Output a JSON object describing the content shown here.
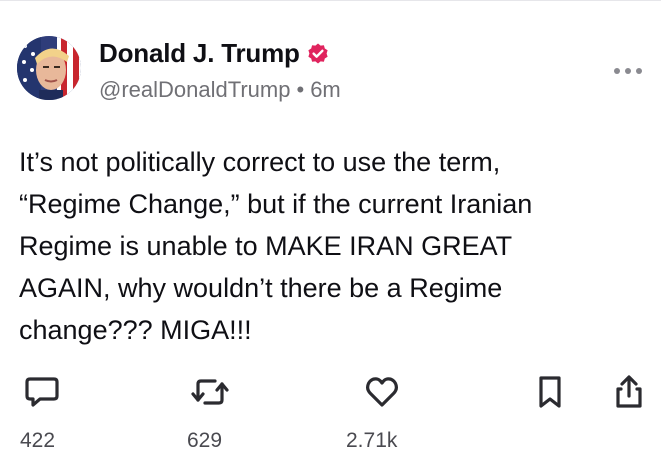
{
  "post": {
    "author": {
      "display_name": "Donald J. Trump",
      "handle": "@realDonaldTrump",
      "verified": true,
      "avatar_icon": "avatar-flag-portrait"
    },
    "separator": "•",
    "timestamp": "6m",
    "text": "It’s not politically correct to use the term,\n“Regime Change,” but if the current Iranian\nRegime is unable to MAKE IRAN GREAT\nAGAIN, why wouldn’t there be a Regime\nchange??? MIGA!!!"
  },
  "actions": {
    "reply": {
      "icon": "comment-icon",
      "count": "422"
    },
    "repost": {
      "icon": "repost-icon",
      "count": "629"
    },
    "like": {
      "icon": "heart-icon",
      "count": "2.71k"
    },
    "bookmark": {
      "icon": "bookmark-icon"
    },
    "share": {
      "icon": "share-icon"
    }
  },
  "colors": {
    "text": "#0f0f14",
    "muted": "#707075",
    "verified": "#e0245e",
    "icon": "#2b2b30"
  }
}
